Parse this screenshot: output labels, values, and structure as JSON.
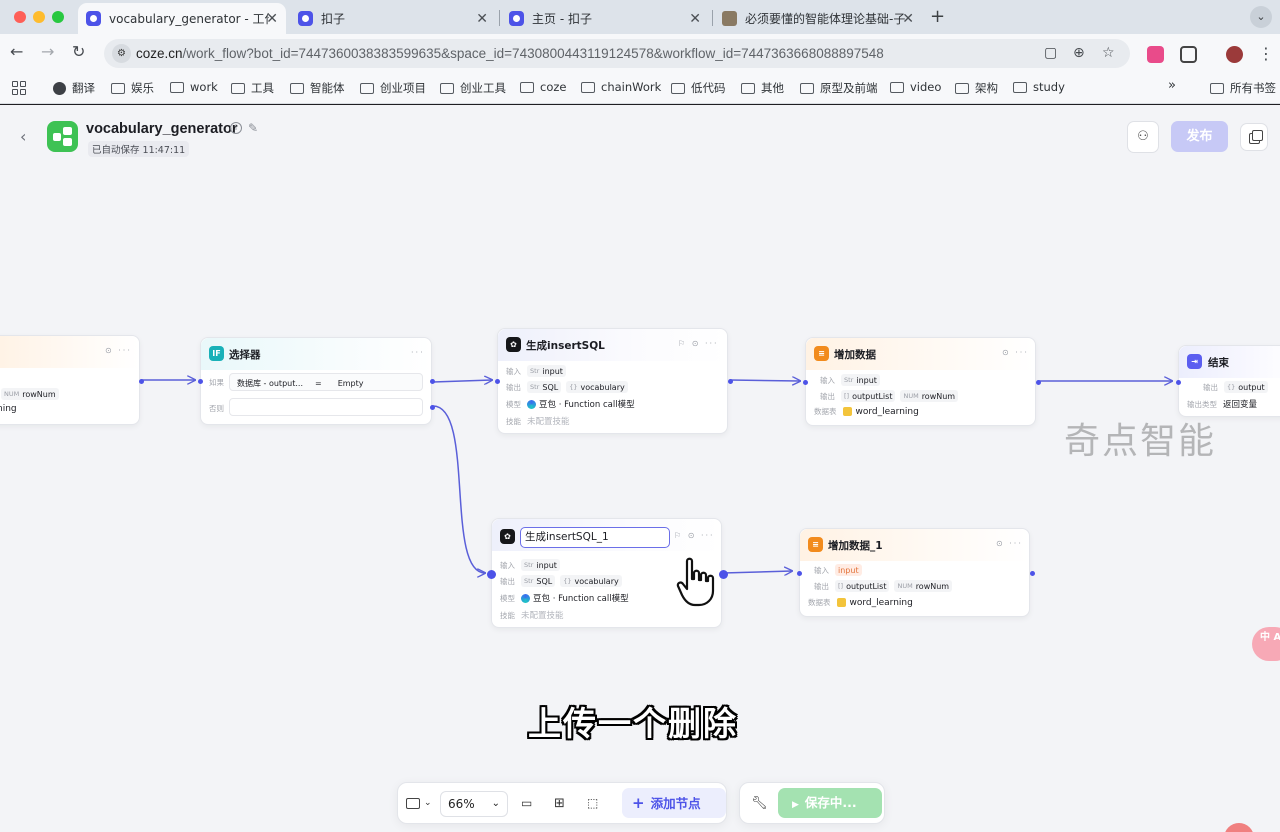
{
  "browser": {
    "tabs": [
      {
        "title": "vocabulary_generator - 工作流"
      },
      {
        "title": "扣子"
      },
      {
        "title": "主页 - 扣子"
      },
      {
        "title": "必须要懂的智能体理论基础-子"
      }
    ],
    "url_host": "coze.cn",
    "url_path": "/work_flow?bot_id=7447360038383599635&space_id=7430800443119124578&workflow_id=7447363668088897548",
    "bookmarks": [
      "翻译",
      "娱乐",
      "work",
      "工具",
      "智能体",
      "创业项目",
      "创业工具",
      "coze",
      "chainWork",
      "低代码",
      "其他",
      "原型及前端",
      "video",
      "架构",
      "study"
    ],
    "more": "»",
    "all_bookmarks": "所有书签"
  },
  "app": {
    "workflow_title": "vocabulary_generator",
    "autosave": "已自动保存 11:47:11",
    "publish": "发布"
  },
  "nodes": {
    "left_partial": {
      "output_tag": "rowNum",
      "output_tp": "NUM",
      "text": "ning"
    },
    "selector": {
      "icon": "IF",
      "title": "选择器",
      "if_label": "如果",
      "left_operand": "数据库 - output...",
      "operator": "=",
      "right_operand": "Empty",
      "else_label": "否则"
    },
    "gen_sql": {
      "title": "生成insertSQL",
      "input_label": "输入",
      "input": "input",
      "input_tp": "Str",
      "output_label": "输出",
      "out1": "SQL",
      "out1_tp": "Str",
      "out2": "vocabulary",
      "out2_tp": "{}",
      "model_label": "模型",
      "model": "豆包 · Function call模型",
      "skill_label": "技能",
      "skill": "未配置技能"
    },
    "add_data": {
      "title": "增加数据",
      "input_label": "输入",
      "input": "input",
      "input_tp": "Str",
      "output_label": "输出",
      "out1": "outputList",
      "out1_tp": "[]",
      "out2": "rowNum",
      "out2_tp": "NUM",
      "table_label": "数据表",
      "table": "word_learning"
    },
    "end": {
      "title": "结束",
      "output_label": "输出",
      "output": "output",
      "output_tp": "{}",
      "type_label": "输出类型",
      "type": "返回变量"
    },
    "gen_sql_1": {
      "title": "生成insertSQL_1",
      "input_label": "输入",
      "input": "input",
      "input_tp": "Str",
      "output_label": "输出",
      "out1": "SQL",
      "out1_tp": "Str",
      "out2": "vocabulary",
      "out2_tp": "{}",
      "model_label": "模型",
      "model": "豆包 · Function call模型",
      "skill_label": "技能",
      "skill": "未配置技能"
    },
    "add_data_1": {
      "title": "增加数据_1",
      "input_label": "输入",
      "input": "input",
      "output_label": "输出",
      "out1": "outputList",
      "out1_tp": "[]",
      "out2": "rowNum",
      "out2_tp": "NUM",
      "table_label": "数据表",
      "table": "word_learning"
    }
  },
  "overlay": {
    "watermark": "奇点智能",
    "subtitle": "上传一个删除",
    "side_pill": "中\nA"
  },
  "bottom_toolbar": {
    "zoom": "66%",
    "add_node": "添加节点",
    "save": "保存中..."
  },
  "colors": {
    "accent": "#4d53e8",
    "connector": "#5a5fd9",
    "save_green": "#a4e2b1",
    "publish_disabled": "#c7c9f6"
  }
}
